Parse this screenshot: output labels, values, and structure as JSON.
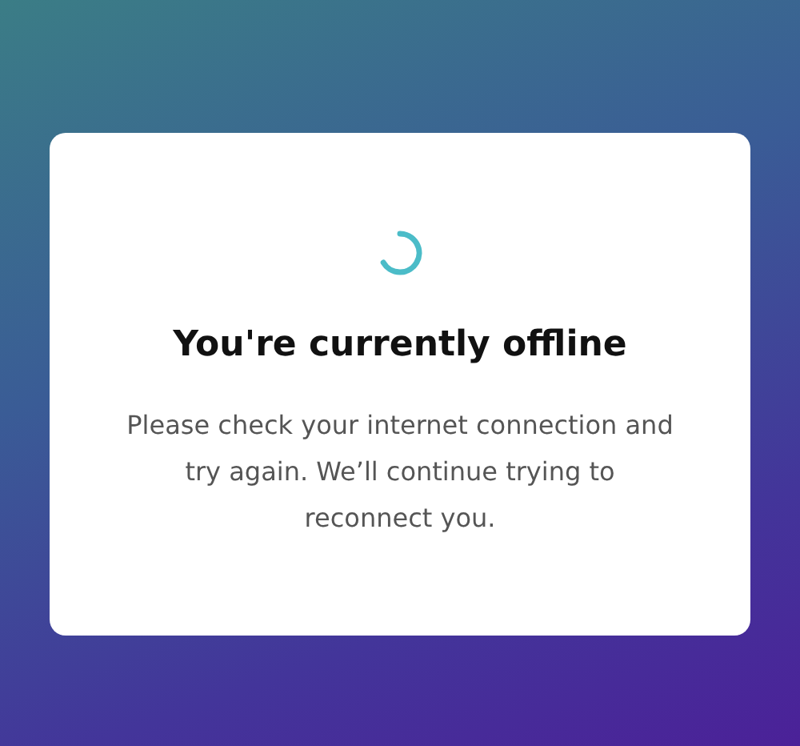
{
  "dialog": {
    "title": "You're currently offline",
    "message": "Please check your internet connection and try again. We’ll continue trying to reconnect you."
  }
}
